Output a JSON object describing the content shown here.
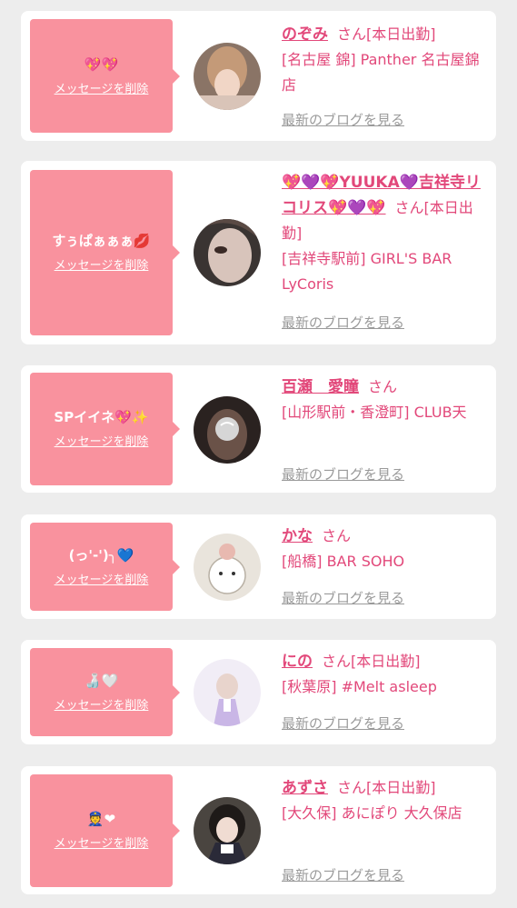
{
  "common": {
    "delete_label": "メッセージを削除",
    "blog_label": "最新のブログを見る",
    "san": "さん",
    "accent_color": "#e2487a",
    "bubble_color": "#f9929e"
  },
  "cards": [
    {
      "message": "💖💖",
      "name": "のぞみ",
      "status": "[本日出勤]",
      "shop": "[名古屋 錦] Panther 名古屋錦店"
    },
    {
      "message": "すぅぱぁぁぁ💋",
      "name": "💖💜💖YUUKA💜吉祥寺リコリス💖💜💖",
      "status": "[本日出勤]",
      "shop": "[吉祥寺駅前] GIRL'S BAR LyCoris"
    },
    {
      "message": "SPイイネ💖✨",
      "name": "百瀬　愛瞳",
      "status": "",
      "shop": "[山形駅前・香澄町] CLUB天"
    },
    {
      "message": "(っ'-')╮💙",
      "name": "かな",
      "status": "",
      "shop": "[船橋] BAR SOHO"
    },
    {
      "message": "🍶🤍",
      "name": "にの",
      "status": "[本日出勤]",
      "shop": "[秋葉原] #Melt asleep"
    },
    {
      "message": "👮❤",
      "name": "あずさ",
      "status": "[本日出勤]",
      "shop": "[大久保] あにぽり 大久保店"
    }
  ]
}
